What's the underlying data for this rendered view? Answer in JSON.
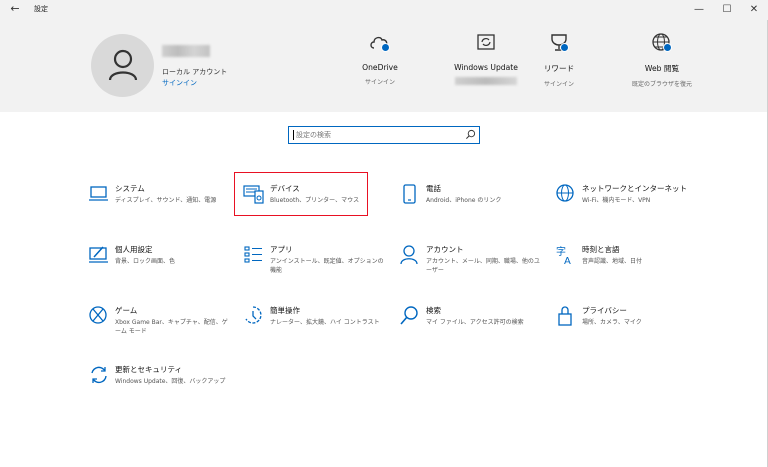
{
  "window": {
    "title": "設定",
    "back": "←",
    "minimize": "—",
    "maximize": "☐",
    "close": "✕"
  },
  "account": {
    "type": "ローカル アカウント",
    "signin": "サインイン"
  },
  "header_items": [
    {
      "title": "OneDrive",
      "sub": "サインイン"
    },
    {
      "title": "Windows Update",
      "sub": ""
    },
    {
      "title": "リワード",
      "sub": "サインイン"
    },
    {
      "title": "Web 閲覧",
      "sub": "既定のブラウザを復元"
    }
  ],
  "search": {
    "placeholder": "設定の検索"
  },
  "categories": [
    {
      "title": "システム",
      "desc": "ディスプレイ、サウンド、通知、電源"
    },
    {
      "title": "デバイス",
      "desc": "Bluetooth、プリンター、マウス"
    },
    {
      "title": "電話",
      "desc": "Android、iPhone のリンク"
    },
    {
      "title": "ネットワークとインターネット",
      "desc": "Wi-Fi、機内モード、VPN"
    },
    {
      "title": "個人用設定",
      "desc": "背景、ロック画面、色"
    },
    {
      "title": "アプリ",
      "desc": "アンインストール、既定値、オプションの機能"
    },
    {
      "title": "アカウント",
      "desc": "アカウント、メール、同期、職場、他のユーザー"
    },
    {
      "title": "時刻と言語",
      "desc": "音声認識、地域、日付"
    },
    {
      "title": "ゲーム",
      "desc": "Xbox Game Bar、キャプチャ、配信、ゲーム モード"
    },
    {
      "title": "簡単操作",
      "desc": "ナレーター、拡大鏡、ハイ コントラスト"
    },
    {
      "title": "検索",
      "desc": "マイ ファイル、アクセス許可の検索"
    },
    {
      "title": "プライバシー",
      "desc": "場所、カメラ、マイク"
    },
    {
      "title": "更新とセキュリティ",
      "desc": "Windows Update、回復、バックアップ"
    }
  ],
  "colors": {
    "accent": "#0067c0",
    "highlight": "#e81123",
    "header_bg": "#f2f2f2"
  }
}
